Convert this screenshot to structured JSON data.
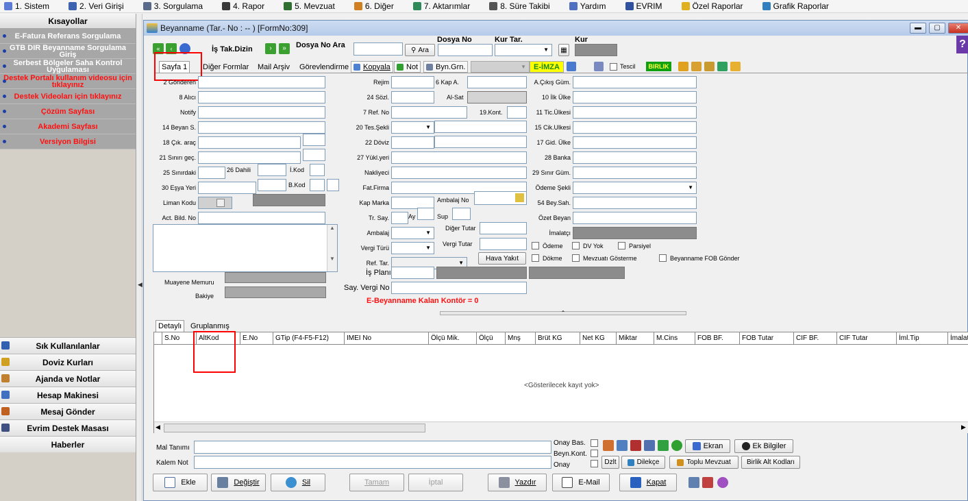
{
  "menubar": [
    {
      "label": "1. Sistem",
      "color": "#5b7bd5"
    },
    {
      "label": "2. Veri Girişi",
      "color": "#3c62b0"
    },
    {
      "label": "3. Sorgulama",
      "color": "#5a6a8a"
    },
    {
      "label": "4. Rapor",
      "color": "#3a3a3a"
    },
    {
      "label": "5. Mevzuat",
      "color": "#2f6f2f"
    },
    {
      "label": "6. Diğer",
      "color": "#d08020"
    },
    {
      "label": "7. Aktarımlar",
      "color": "#2f8a5a"
    },
    {
      "label": "8. Süre Takibi",
      "color": "#555"
    },
    {
      "label": "Yardım",
      "color": "#5070c0"
    },
    {
      "label": "EVRIM",
      "color": "#3050a0"
    },
    {
      "label": "Özel Raporlar",
      "color": "#e0b020"
    },
    {
      "label": "Grafik Raporlar",
      "color": "#3080c0"
    }
  ],
  "sidebar": {
    "title": "Kısayollar",
    "items": [
      {
        "label": "E-Fatura Referans Sorgulama",
        "red": false
      },
      {
        "label": "GTB DIR Beyanname Sorgulama Giriş",
        "red": false
      },
      {
        "label": "Serbest Bölgeler Saha Kontrol Uygulaması",
        "red": false
      },
      {
        "label": "Destek Portalı kullanım videosu için tıklayınız",
        "red": true
      },
      {
        "label": "Destek Videoları için tıklayınız",
        "red": true
      },
      {
        "label": "Çözüm Sayfası",
        "red": true
      },
      {
        "label": "Akademi Sayfası",
        "red": true
      },
      {
        "label": "Versiyon Bilgisi",
        "red": true
      }
    ],
    "bottom": [
      {
        "label": "Sık Kullanılanlar",
        "color": "#3060b0"
      },
      {
        "label": "Doviz Kurları",
        "color": "#d0a020"
      },
      {
        "label": "Ajanda ve Notlar",
        "color": "#c08030"
      },
      {
        "label": "Hesap Makinesi",
        "color": "#4070c0"
      },
      {
        "label": "Mesaj Gönder",
        "color": "#c06020"
      },
      {
        "label": "Evrim Destek Masası",
        "color": "#405080"
      },
      {
        "label": "Haberler",
        "color": ""
      }
    ]
  },
  "window": {
    "title": "Beyanname (Tar.- No : -- ) [FormNo:309]",
    "is_tak_dizin": "İş Tak.Dizin",
    "dosya_no_ara": "Dosya No Ara",
    "ara_button": "Ara",
    "dosya_no_label": "Dosya No",
    "kur_tar_label": "Kur Tar.",
    "kur_label": "Kur"
  },
  "tabs": [
    "Sayfa 1",
    "Diğer Formlar",
    "Mail Arşiv",
    "Görevlendirme",
    "Kopyala",
    "Not",
    "Byn.Grn."
  ],
  "tabbar": {
    "eimza": "E-İMZA",
    "tescil": "Tescil",
    "birlik": "BIRLIK"
  },
  "form_left": [
    {
      "label": "2 Gönderen"
    },
    {
      "label": "8 Alıcı"
    },
    {
      "label": "Notify"
    },
    {
      "label": "14 Beyan S."
    },
    {
      "label": "18 Çık. araç"
    },
    {
      "label": "21 Sınırı geç."
    },
    {
      "label": "25 Sınırdaki"
    },
    {
      "label": "30 Eşya Yeri"
    },
    {
      "label": "Liman Kodu"
    },
    {
      "label": "Act. Bild. No"
    }
  ],
  "form_left_extra": {
    "dahili": "26 Dahili",
    "ikod": "İ.Kod",
    "bkod": "B.Kod",
    "muayene": "Muayene Memuru",
    "bakiye": "Bakiye"
  },
  "form_mid": [
    {
      "label": "Rejim"
    },
    {
      "label": "24 Sözl."
    },
    {
      "label": "7 Ref. No"
    },
    {
      "label": "20 Tes.Şekli"
    },
    {
      "label": "22 Döviz"
    },
    {
      "label": "27 Yükl.yeri"
    },
    {
      "label": "Nakliyeci"
    },
    {
      "label": "Fat.Firma"
    },
    {
      "label": "Kap Marka"
    },
    {
      "label": "Tr. Say."
    },
    {
      "label": "Ambalaj"
    },
    {
      "label": "Vergi Türü"
    },
    {
      "label": "Ref. Tar."
    }
  ],
  "form_mid_extra": {
    "kap_a": "6 Kap A.",
    "al_sat": "Al-Sat",
    "kont": "19.Kont.",
    "ambalaj_no": "Ambalaj No",
    "ay": "Ay",
    "sup": "Sup",
    "diger_tutar": "Diğer Tutar",
    "vergi_tutar": "Vergi Tutar",
    "hava_yakit": "Hava Yakıt",
    "is_plani": "İş Planı",
    "say_vergi_no": "Say. Vergi No",
    "kontor": "E-Beyanname Kalan Kontör = 0"
  },
  "form_right": [
    {
      "label": "A.Çıkış Güm."
    },
    {
      "label": "10 İlk Ülke"
    },
    {
      "label": "11 Tic.Ülkesi"
    },
    {
      "label": "15 Cik.Ulkesi"
    },
    {
      "label": "17 Gid. Ülke"
    },
    {
      "label": "28 Banka"
    },
    {
      "label": "29 Sınır Güm."
    },
    {
      "label": "Ödeme Şekli"
    },
    {
      "label": "54 Bey.Sah."
    },
    {
      "label": "Özet Beyan"
    },
    {
      "label": "İmalatçı"
    }
  ],
  "checks": [
    "Ödeme",
    "DV Yok",
    "Parsiyel",
    "Dökme",
    "Mevzuatı Gösterme",
    "Beyanname FOB Gönder"
  ],
  "grid": {
    "tabs": [
      "Detaylı",
      "Gruplanmış"
    ],
    "columns": [
      "S.No",
      "AltKod",
      "E.No",
      "GTip (F4-F5-F12)",
      "IMEI No",
      "Ölçü Mik.",
      "Ölçü",
      "Mnş",
      "Brüt KG",
      "Net KG",
      "Miktar",
      "M.Cins",
      "FOB BF.",
      "FOB Tutar",
      "CIF BF.",
      "CIF Tutar",
      "İml.Tip",
      "İmalatçı"
    ],
    "empty": "<Gösterilecek kayıt yok>"
  },
  "bottom_form": {
    "mal_tanimi": "Mal Tanımı",
    "kalem_not": "Kalem Not",
    "onay_bas": "Onay Bas.",
    "beyn_kont": "Beyn.Kont.",
    "onay": "Onay",
    "ekran": "Ekran",
    "ek_bilgiler": "Ek Bilgiler",
    "dzlt": "Dzlt",
    "dilekce": "Dilekçe",
    "toplu_mevzuat": "Toplu Mevzuat",
    "birlik_alt": "Birlik Alt Kodları"
  },
  "actions": {
    "ekle": "Ekle",
    "degistir": "Değiştir",
    "sil": "Sil",
    "tamam": "Tamam",
    "iptal": "İptal",
    "yazdir": "Yazdır",
    "email": "E-Mail",
    "kapat": "Kapat"
  }
}
